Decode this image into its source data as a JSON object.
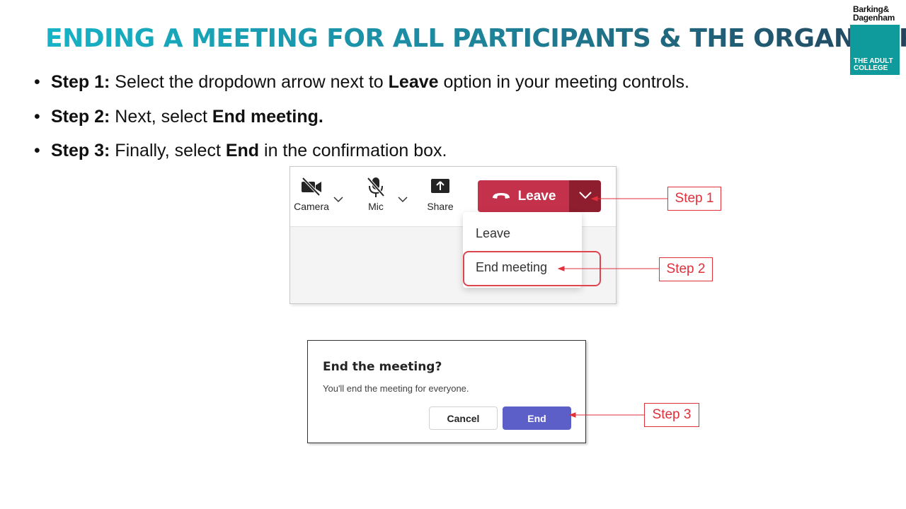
{
  "title": "ENDING A MEETING FOR ALL PARTICIPANTS & THE ORGANISER",
  "logo": {
    "line1": "Barking&",
    "line2": "Dagenham",
    "box_line1": "THE ADULT",
    "box_line2": "COLLEGE",
    "box_color": "#0f9b9b"
  },
  "steps": [
    {
      "bullet": "•",
      "label": "Step 1:",
      "t1": " Select the dropdown arrow next to ",
      "b1": "Leave",
      "t2": " option in your meeting controls."
    },
    {
      "bullet": "•",
      "label": "Step 2:",
      "t1": " Next, select ",
      "b1": "End meeting."
    },
    {
      "bullet": "•",
      "label": "Step 3:",
      "t1": " Finally, select ",
      "b1": "End",
      "t2": " in the confirmation box."
    }
  ],
  "toolbar": {
    "camera_label": "Camera",
    "mic_label": "Mic",
    "share_label": "Share",
    "leave_label": "Leave",
    "leave_color": "#c4314b"
  },
  "menu": {
    "items": [
      "Leave",
      "End meeting"
    ]
  },
  "dialog": {
    "title": "End the meeting?",
    "text": "You'll end the meeting for everyone.",
    "cancel_label": "Cancel",
    "end_label": "End",
    "end_color": "#5b5fc7"
  },
  "callouts": [
    "Step 1",
    "Step 2",
    "Step 3"
  ],
  "accent_red": "#e0303b"
}
